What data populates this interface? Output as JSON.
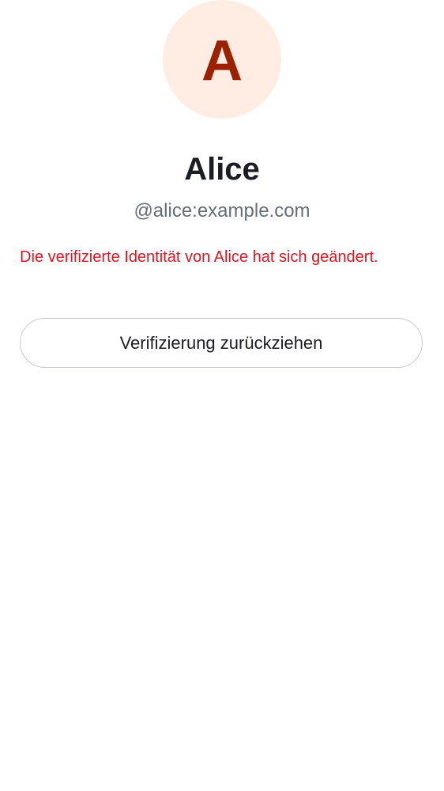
{
  "profile": {
    "avatar_initial": "A",
    "display_name": "Alice",
    "user_id": "@alice:example.com"
  },
  "verification": {
    "warning_text": "Die verifizierte Identität von Alice hat sich geändert.",
    "withdraw_button_label": "Verifizierung zurückziehen"
  },
  "colors": {
    "avatar_background": "#ffede3",
    "avatar_initial": "#9b2200",
    "warning": "#d51928",
    "primary_text": "#1b1d22",
    "secondary_text": "#656d77",
    "button_border": "#c6c9ce"
  }
}
